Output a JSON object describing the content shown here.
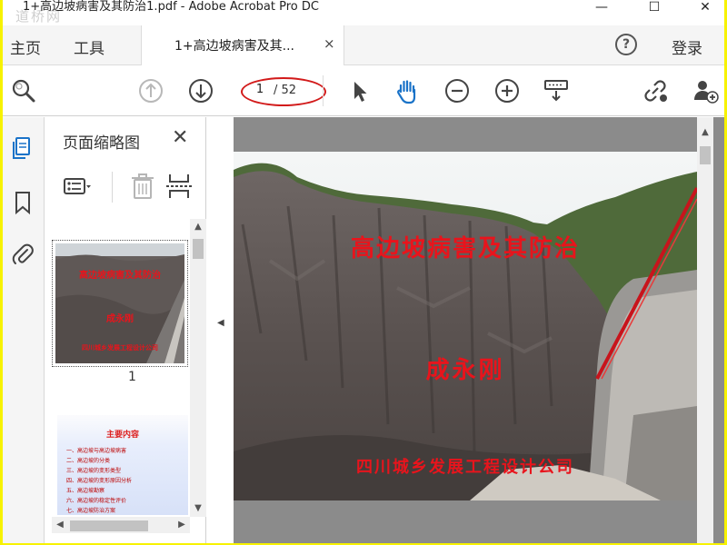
{
  "window": {
    "title": "1+高边坡病害及其防治1.pdf - Adobe Acrobat Pro DC",
    "watermark": "道桥网",
    "minimize": "—",
    "maximize": "☐",
    "close": "✕"
  },
  "menu": {
    "home": "主页",
    "tools": "工具",
    "tab_label": "1+高边坡病害及其...",
    "tab_close": "×",
    "help": "?",
    "login": "登录"
  },
  "toolbar": {
    "page_current": "1",
    "page_total": "/ 52",
    "icons": [
      "search-icon",
      "prev-page-icon",
      "next-page-icon",
      "select-cursor-icon",
      "hand-tool-icon",
      "zoom-out-icon",
      "zoom-in-icon",
      "fit-page-icon",
      "share-link-icon",
      "add-user-icon"
    ],
    "accent_color": "#1a73c8",
    "highlight_color": "#d21a1a"
  },
  "rail": {
    "icons": [
      "page-thumbnails-icon",
      "bookmark-icon",
      "attachment-icon"
    ]
  },
  "thumbnails": {
    "title": "页面缩略图",
    "close": "✕",
    "page1_label": "1",
    "page1_title": "高边坡病害及其防治",
    "page1_author": "成永刚",
    "page1_company": "四川城乡发展工程设计公司",
    "page2_title": "主要内容",
    "page2_items": [
      "一、高边坡与高边坡病害",
      "二、高边坡的分类",
      "三、高边坡的变形类型",
      "四、高边坡的变形原因分析",
      "五、高边坡勘察",
      "六、高边坡的稳定性评价",
      "七、高边坡防治方案"
    ]
  },
  "document": {
    "title": "高边坡病害及其防治",
    "author": "成永刚",
    "company": "四川城乡发展工程设计公司",
    "text_color": "#e8141c"
  }
}
